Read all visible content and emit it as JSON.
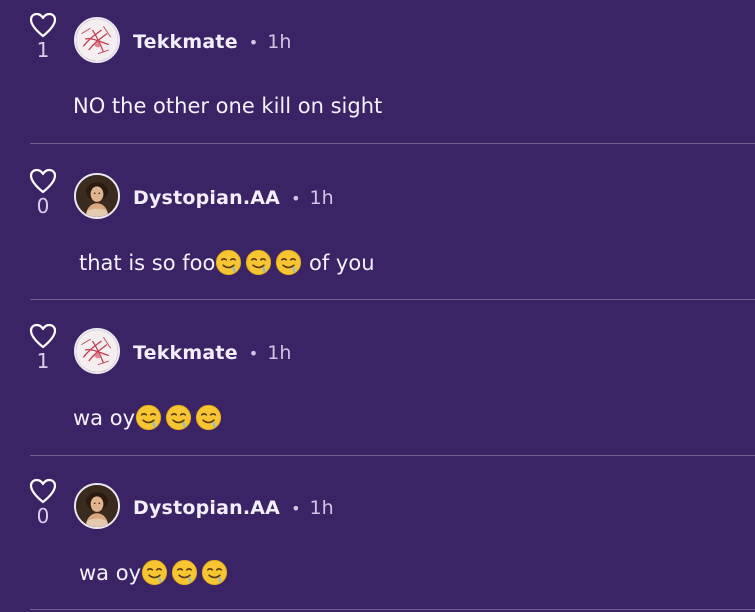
{
  "comments": [
    {
      "likes": "1",
      "username": "Tekkmate",
      "separator": "•",
      "time": "1h",
      "text": "NO the other one kill on sight",
      "text_after": "",
      "emoji_count": 0,
      "avatar": "sketch-drawing-avatar"
    },
    {
      "likes": "0",
      "username": "Dystopian.AA",
      "separator": "•",
      "time": "1h",
      "text": "that is so foo",
      "text_after": " of you",
      "emoji_count": 3,
      "avatar": "classical-portrait-avatar"
    },
    {
      "likes": "1",
      "username": "Tekkmate",
      "separator": "•",
      "time": "1h",
      "text": "wa oy",
      "text_after": "",
      "emoji_count": 3,
      "avatar": "sketch-drawing-avatar"
    },
    {
      "likes": "0",
      "username": "Dystopian.AA",
      "separator": "•",
      "time": "1h",
      "text": "wa oy",
      "text_after": "",
      "emoji_count": 3,
      "avatar": "classical-portrait-avatar"
    }
  ],
  "emoji_name": "drooling-face-emoji",
  "colors": {
    "background": "#3a2466",
    "divider": "rgba(255,255,255,0.28)",
    "emoji_yellow": "#f7c531"
  }
}
